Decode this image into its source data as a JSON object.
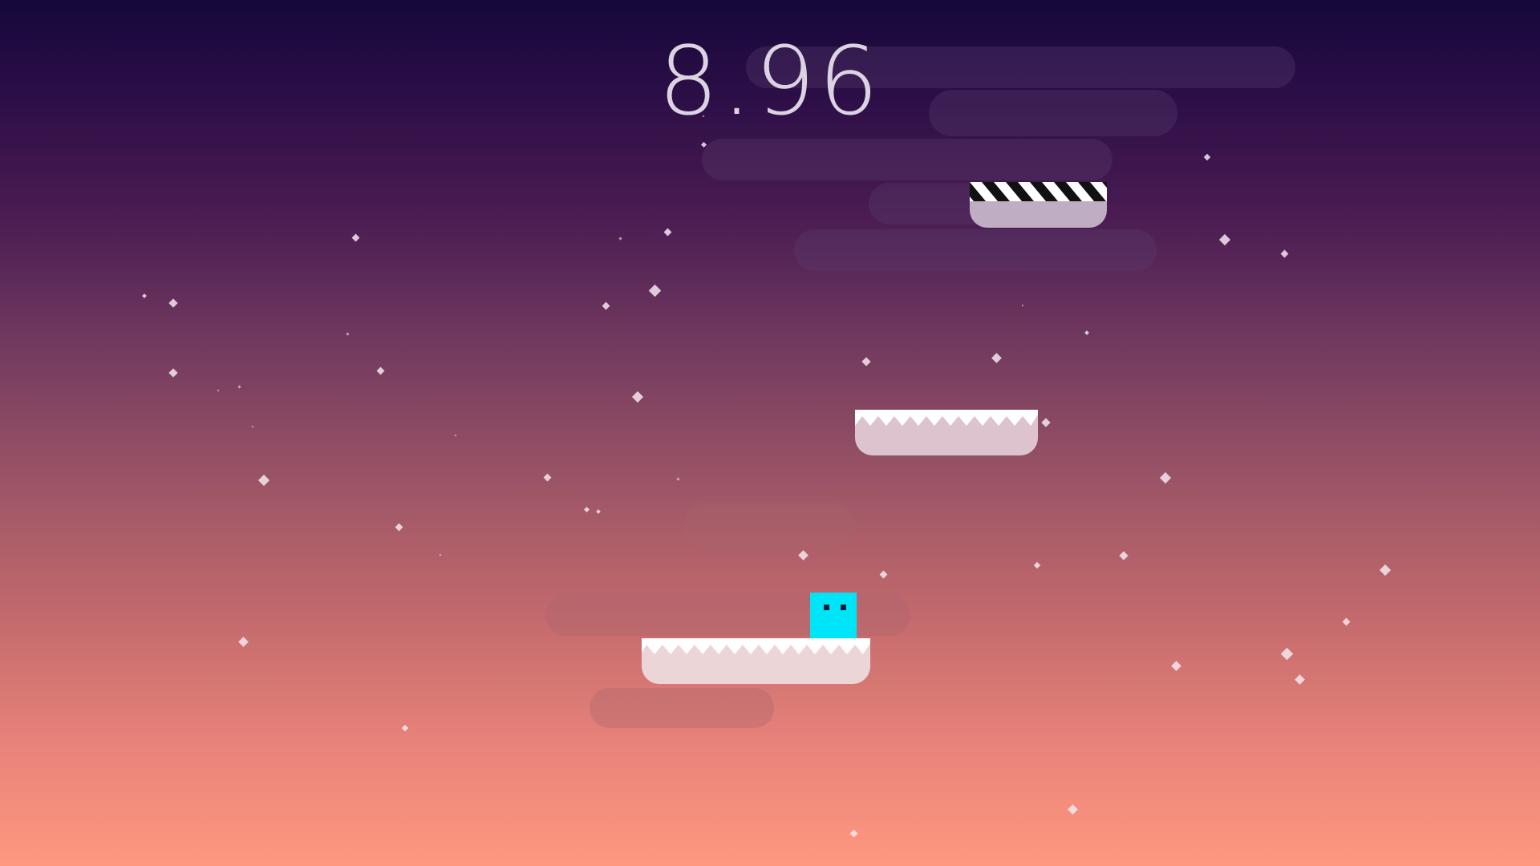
{
  "hud": {
    "timer": "8.96"
  },
  "player": {
    "color": "#00e4f7",
    "shape": "square-with-eyes"
  },
  "platforms": [
    {
      "kind": "finish",
      "stripe": "black-white-hazard"
    },
    {
      "kind": "spiky",
      "stripe": "white-zigzag"
    },
    {
      "kind": "spiky",
      "stripe": "white-zigzag"
    }
  ],
  "colors": {
    "sky_top": "#15083a",
    "sky_bottom": "#ff987f",
    "timer": "#dcd3e2",
    "sparkle": "#f5e6ee"
  }
}
